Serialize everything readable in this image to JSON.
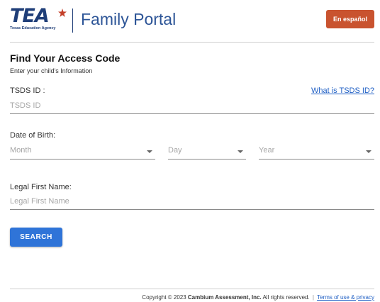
{
  "colors": {
    "brand": "#1f3e78",
    "accent": "#2f74d8",
    "lang_button": "#c9532f",
    "link": "#1f5fc4"
  },
  "header": {
    "logo_text": "TEA",
    "logo_subtext": "Texas Education Agency",
    "logo_icon": "star-icon",
    "title": "Family Portal",
    "lang_button": "En español"
  },
  "page": {
    "title": "Find Your Access Code",
    "subtitle": "Enter your child's Information"
  },
  "form": {
    "tsds": {
      "label": "TSDS ID :",
      "placeholder": "TSDS ID",
      "help_link": "What is TSDS ID?"
    },
    "dob": {
      "label": "Date of Birth:",
      "month": "Month",
      "day": "Day",
      "year": "Year",
      "caret_icon": "caret-down-icon"
    },
    "first_name": {
      "label": "Legal First Name:",
      "placeholder": "Legal First Name"
    },
    "search_button": "SEARCH"
  },
  "footer": {
    "copyright_prefix": "Copyright © 2023 ",
    "company": "Cambium Assessment, Inc.",
    "copyright_suffix": " All rights reserved.",
    "separator": "|",
    "terms_link": "Terms of use & privacy"
  }
}
